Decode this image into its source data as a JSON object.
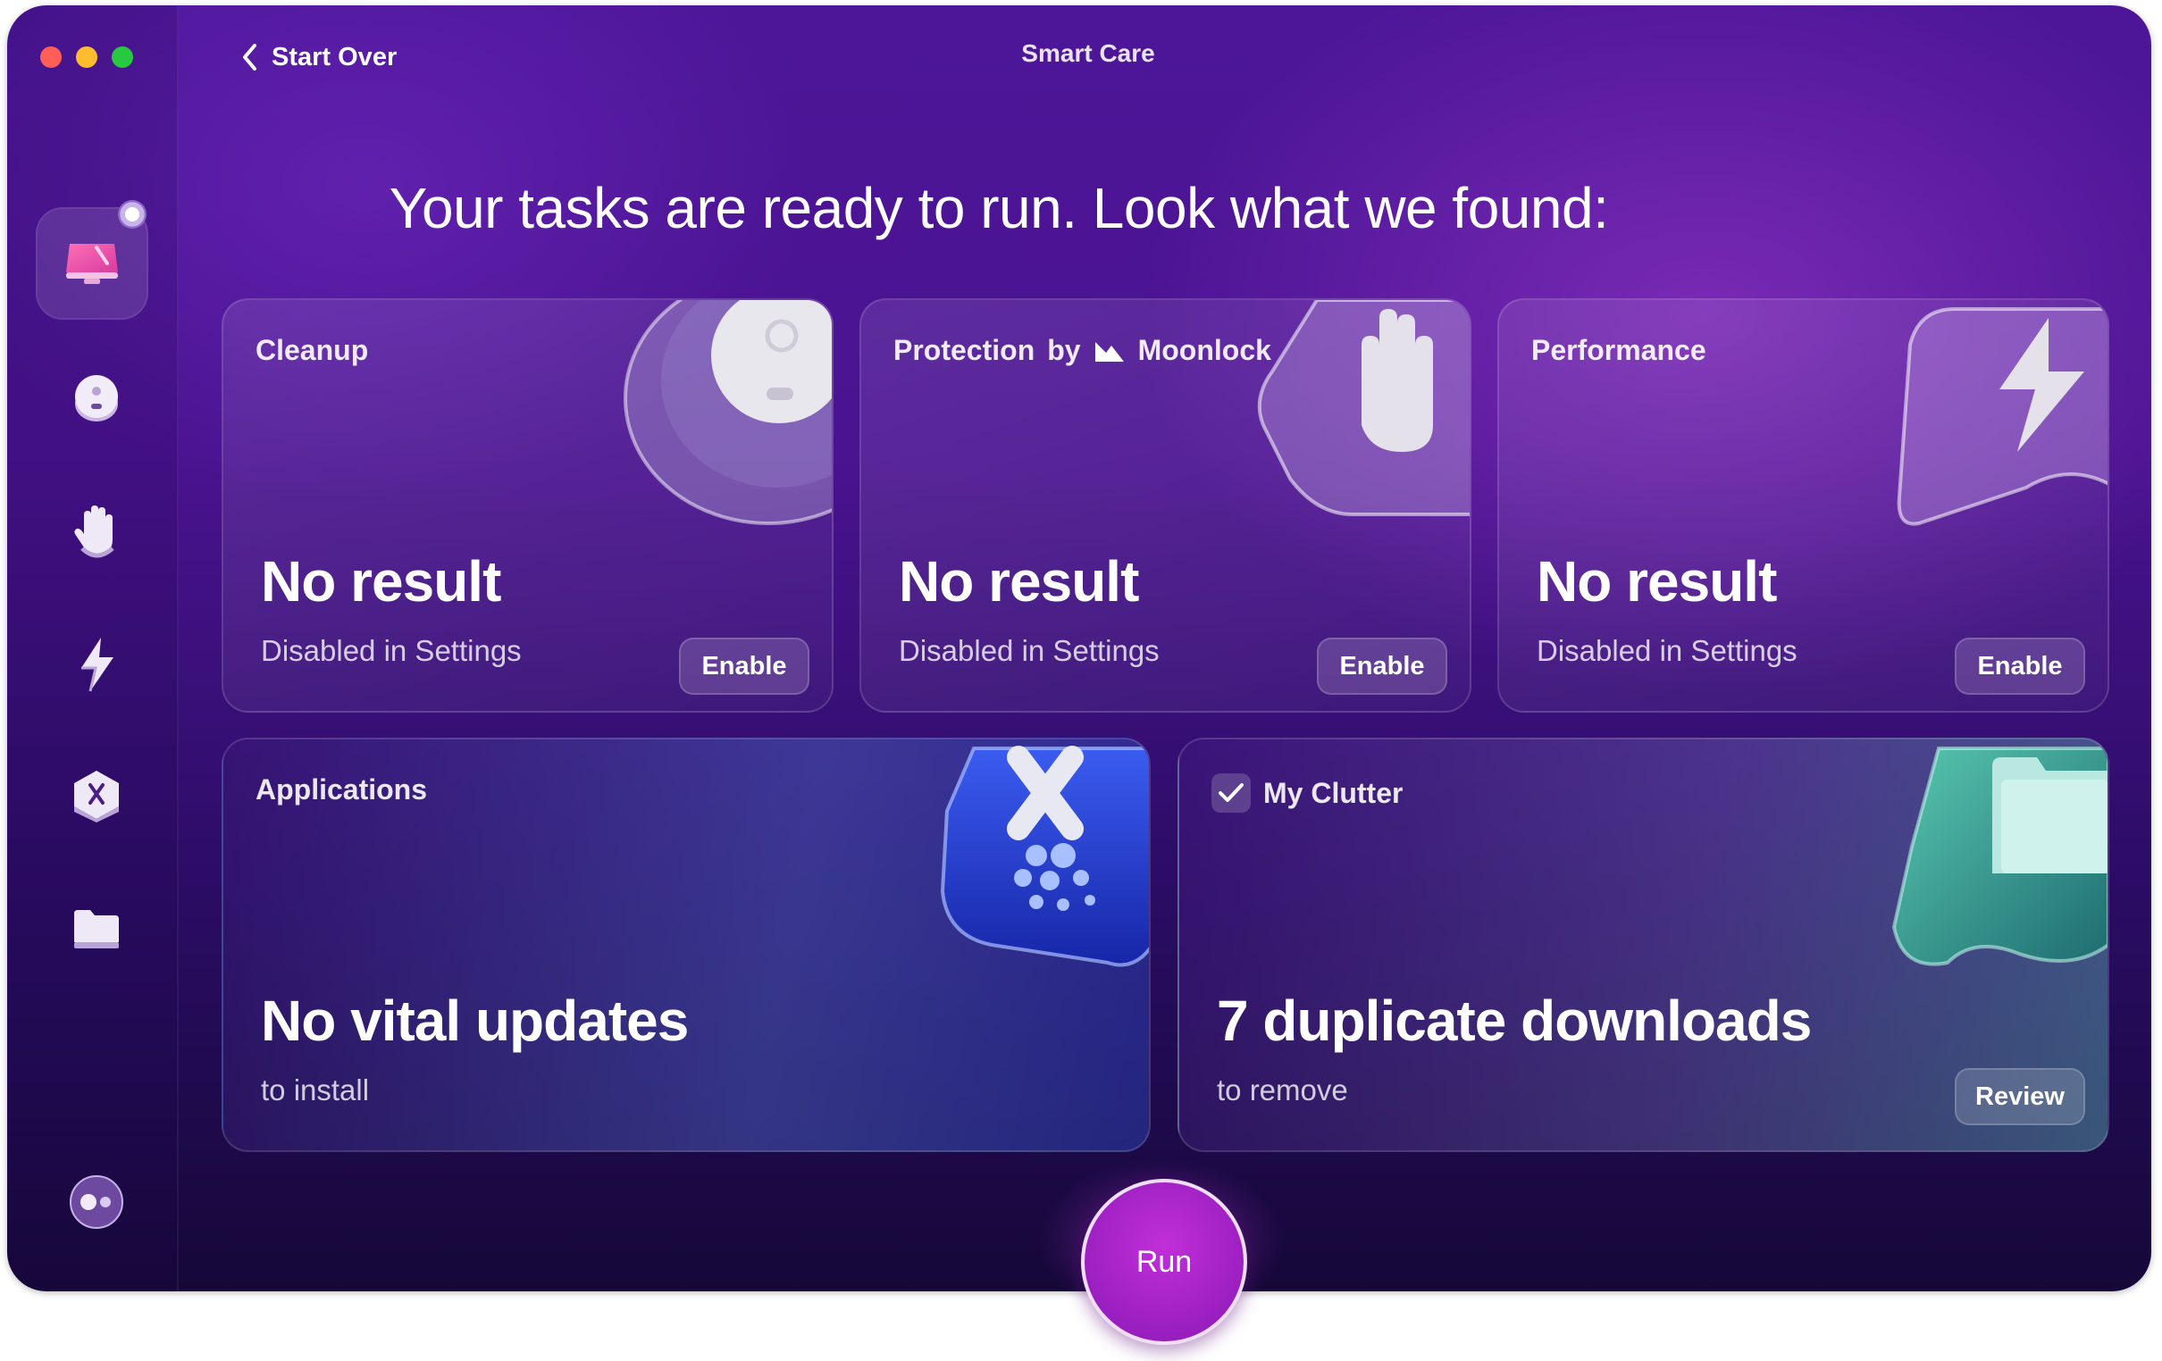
{
  "window": {
    "title": "Smart Care"
  },
  "topbar": {
    "back_label": "Start Over"
  },
  "headline": "Your tasks are ready to run. Look what we found:",
  "sidebar": {
    "items": [
      {
        "name": "smart-care",
        "icon": "smart-care-monitor-icon",
        "active": true
      },
      {
        "name": "cleanup",
        "icon": "cleanup-disc-icon"
      },
      {
        "name": "protection",
        "icon": "hand-icon"
      },
      {
        "name": "performance",
        "icon": "lightning-icon"
      },
      {
        "name": "applications",
        "icon": "applications-icon"
      },
      {
        "name": "my-clutter",
        "icon": "folder-icon"
      }
    ],
    "bottom_icon": "assistant-icon"
  },
  "cards": {
    "cleanup": {
      "label": "Cleanup",
      "result": "No result",
      "sub": "Disabled in Settings",
      "button": "Enable"
    },
    "protection": {
      "label_prefix": "Protection",
      "label_by": "by",
      "label_brand": "Moonlock",
      "result": "No result",
      "sub": "Disabled in Settings",
      "button": "Enable"
    },
    "performance": {
      "label": "Performance",
      "result": "No result",
      "sub": "Disabled in Settings",
      "button": "Enable"
    },
    "applications": {
      "label": "Applications",
      "result": "No vital updates",
      "sub": "to install"
    },
    "clutter": {
      "label": "My Clutter",
      "checked": true,
      "result": "7 duplicate downloads",
      "sub": "to remove",
      "button": "Review"
    }
  },
  "run_button": "Run",
  "colors": {
    "accent": "#a323c9",
    "background_top": "#4d1699",
    "background_bottom": "#150838"
  }
}
